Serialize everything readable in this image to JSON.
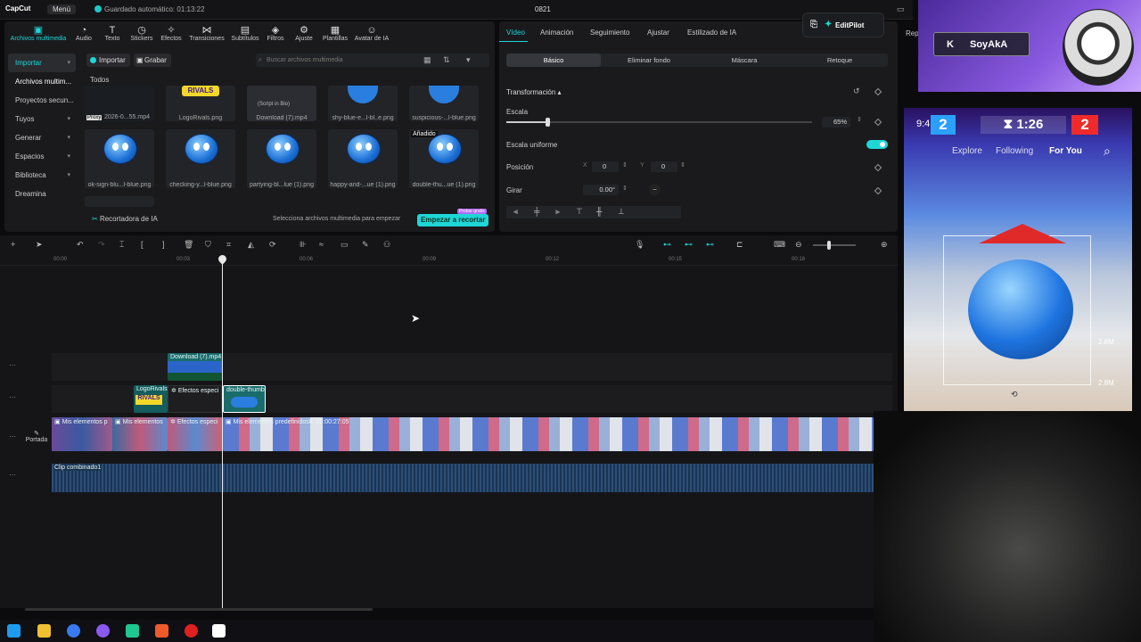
{
  "topbar": {
    "logo": "CapCut",
    "menu": "Menú",
    "autosave": "Guardado automático: 01:13:22",
    "project": "0821"
  },
  "tools": [
    {
      "label": "Archivos multimedia",
      "icon": "media-icon"
    },
    {
      "label": "Audio",
      "icon": "audio-icon"
    },
    {
      "label": "Texto",
      "icon": "text-icon"
    },
    {
      "label": "Stickers",
      "icon": "sticker-icon"
    },
    {
      "label": "Efectos",
      "icon": "effects-icon"
    },
    {
      "label": "Transiciones",
      "icon": "transition-icon"
    },
    {
      "label": "Subtítulos",
      "icon": "caption-icon"
    },
    {
      "label": "Filtros",
      "icon": "filter-icon"
    },
    {
      "label": "Ajuste",
      "icon": "adjust-icon"
    },
    {
      "label": "Plantillas",
      "icon": "template-icon"
    },
    {
      "label": "Avatar de IA",
      "icon": "avatar-icon"
    }
  ],
  "sidenav": [
    {
      "label": "Importar",
      "chev": "▾"
    },
    {
      "label": "Archivos multim..."
    },
    {
      "label": "Proyectos secun..."
    },
    {
      "label": "Tuyos",
      "chev": "▾"
    },
    {
      "label": "Generar",
      "chev": "▾"
    },
    {
      "label": "Espacios",
      "chev": "▾"
    },
    {
      "label": "Biblioteca",
      "chev": "▾"
    },
    {
      "label": "Dreamina"
    }
  ],
  "media": {
    "import_btn": "Importar",
    "record_btn": "Grabar",
    "search_placeholder": "Buscar archivos multimedia",
    "all_label": "Todos",
    "row1": [
      "2026-0...55.mp4",
      "LogoRivals.png",
      "Download (7).mp4",
      "shy-blue-e...l-bl..e.png",
      "suspicious-...l-blue.png"
    ],
    "row1_proxy": "Proxy",
    "row1_overlay": "(Script in Bio)",
    "row2": [
      "ok-sign-blu...l-blue.png",
      "checking-y...l-blue.png",
      "partying-bl...lue (1).png",
      "happy-and-...ue (1).png",
      "double-thu...ue (1).png"
    ],
    "added_tag": "Añadido",
    "recorder": "Recortadora de IA",
    "hint": "Selecciona archivos multimedia para empezar",
    "start": "Empezar a recortar",
    "trial": "Probar gratis"
  },
  "right": {
    "tabs": [
      "Vídeo",
      "Animación",
      "Seguimiento",
      "Ajustar",
      "Estilizado de IA"
    ],
    "editpilot": "EditPilot",
    "rep": "Rep",
    "subtabs": [
      "Básico",
      "Eliminar fondo",
      "Máscara",
      "Retoque"
    ],
    "section": "Transformación",
    "scale_label": "Escala",
    "scale_value": "65%",
    "scale_fraction": 0.65,
    "uniform_label": "Escala uniforme",
    "position_label": "Posición",
    "pos_x_label": "X",
    "pos_x": "0",
    "pos_y_label": "Y",
    "pos_y": "0",
    "rotate_label": "Girar",
    "rotate_value": "0.00°",
    "rotate_dash": "−"
  },
  "timeline": {
    "ticks": [
      "00:00",
      "00:03",
      "00:06",
      "00:09",
      "00:12",
      "00:15",
      "00:18"
    ],
    "cover": "Portada",
    "clip_download": "Download (7).mp4",
    "clip_logo": "LogoRivals",
    "clip_effects1": "Efectos especi",
    "clip_double": "double-thumb",
    "clip_mis1": "Mis elementos p",
    "clip_mis2": "Mis elementos",
    "clip_effects2": "Efectos especi",
    "clip_main": "Mis elementos predefinidos8",
    "clip_main_time": "00:00:27:05",
    "audio": "Clip combinado1"
  },
  "stream": {
    "name": "SoyAkA",
    "initial": "K"
  },
  "tiktok": {
    "time": "1:26",
    "score_left": "2",
    "score_right": "2",
    "clock": "9:41",
    "nav": [
      "Explore",
      "Following",
      "For You"
    ],
    "likes": "2.8M",
    "comments": "2.8M"
  }
}
